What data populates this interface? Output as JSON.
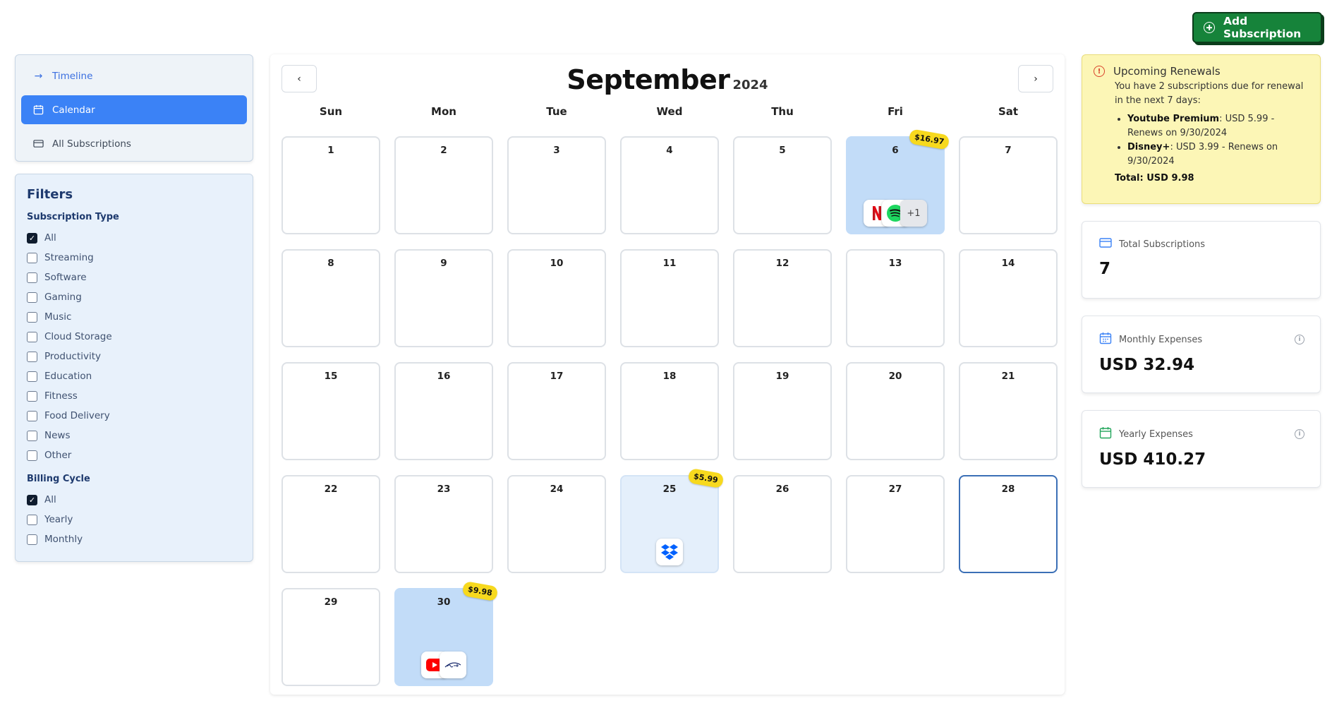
{
  "header": {
    "add_label": "Add Subscription"
  },
  "nav": {
    "timeline": "Timeline",
    "calendar": "Calendar",
    "all": "All Subscriptions"
  },
  "filters": {
    "title": "Filters",
    "type_title": "Subscription Type",
    "types": [
      "All",
      "Streaming",
      "Software",
      "Gaming",
      "Music",
      "Cloud Storage",
      "Productivity",
      "Education",
      "Fitness",
      "Food Delivery",
      "News",
      "Other"
    ],
    "cycle_title": "Billing Cycle",
    "cycles": [
      "All",
      "Yearly",
      "Monthly"
    ]
  },
  "calendar": {
    "month": "September",
    "year": "2024",
    "weekdays": [
      "Sun",
      "Mon",
      "Tue",
      "Wed",
      "Thu",
      "Fri",
      "Sat"
    ],
    "days": [
      "1",
      "2",
      "3",
      "4",
      "5",
      "6",
      "7",
      "8",
      "9",
      "10",
      "11",
      "12",
      "13",
      "14",
      "15",
      "16",
      "17",
      "18",
      "19",
      "20",
      "21",
      "22",
      "23",
      "24",
      "25",
      "26",
      "27",
      "28",
      "29",
      "30"
    ],
    "badge_6": "$16.97",
    "badge_25": "$5.99",
    "badge_30": "$9.98",
    "more_6": "+1"
  },
  "renewals": {
    "title": "Upcoming Renewals",
    "desc": "You have 2 subscriptions due for renewal in the next 7 days:",
    "item1_name": "Youtube Premium",
    "item1_rest": ": USD 5.99 - Renews on 9/30/2024",
    "item2_name": "Disney+",
    "item2_rest": ": USD 3.99 - Renews on 9/30/2024",
    "total": "Total: USD 9.98"
  },
  "stats": {
    "total_label": "Total Subscriptions",
    "total_value": "7",
    "monthly_label": "Monthly Expenses",
    "monthly_value": "USD 32.94",
    "yearly_label": "Yearly Expenses",
    "yearly_value": "USD 410.27"
  },
  "colors": {
    "primary": "#3b82f6",
    "add_button": "#16833a",
    "badge": "#f7d91e",
    "alert_bg": "#fcf6b6"
  }
}
